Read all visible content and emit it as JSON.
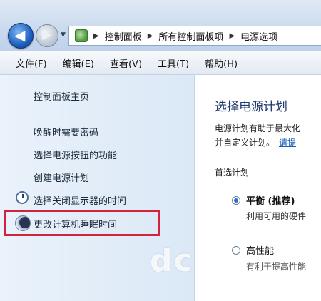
{
  "breadcrumb": {
    "items": [
      "控制面板",
      "所有控制面板项",
      "电源选项"
    ]
  },
  "menu": {
    "items": [
      "文件(F)",
      "编辑(E)",
      "查看(V)",
      "工具(T)",
      "帮助(H)"
    ]
  },
  "sidebar": {
    "home": "控制面板主页",
    "links": [
      "唤醒时需要密码",
      "选择电源按钮的功能",
      "创建电源计划",
      "选择关闭显示器的时间",
      "更改计算机睡眠时间"
    ],
    "highlight_color": "#d3233a"
  },
  "main": {
    "title": "选择电源计划",
    "desc_line1": "电源计划有助于最大化",
    "desc_line2": "并自定义计划。",
    "desc_link": "请提",
    "preferred_label": "首选计划",
    "plans": [
      {
        "name": "平衡 (推荐)",
        "desc": "利用可用的硬件",
        "selected": true
      },
      {
        "name": "高性能",
        "desc": "有利于提高性能",
        "selected": false
      }
    ]
  },
  "watermark": "dc",
  "colors": {
    "accent": "#1e3a6e",
    "link": "#1a5fb4"
  }
}
